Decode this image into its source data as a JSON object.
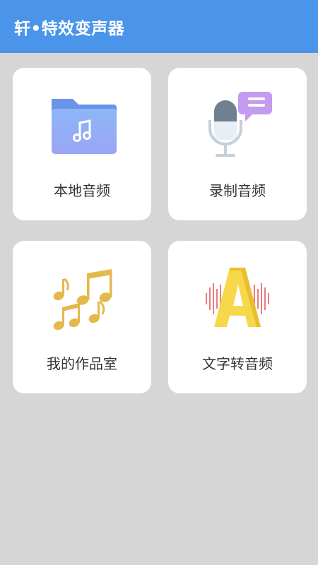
{
  "app": {
    "title": "轩•特效变声器"
  },
  "menu": {
    "items": [
      {
        "label": "本地音频",
        "icon": "music-folder-icon"
      },
      {
        "label": "录制音频",
        "icon": "microphone-icon"
      },
      {
        "label": "我的作品室",
        "icon": "music-notes-icon"
      },
      {
        "label": "文字转音频",
        "icon": "letter-a-soundwave-icon"
      }
    ]
  },
  "colors": {
    "app_bar": "#4a95ea",
    "background": "#d6d6d6",
    "card": "#ffffff",
    "folder": "#7fa8f5",
    "mic_bubble": "#b88ae8",
    "notes": "#e4b84a",
    "letter": "#f6d548",
    "wave": "#ea6a6a"
  }
}
